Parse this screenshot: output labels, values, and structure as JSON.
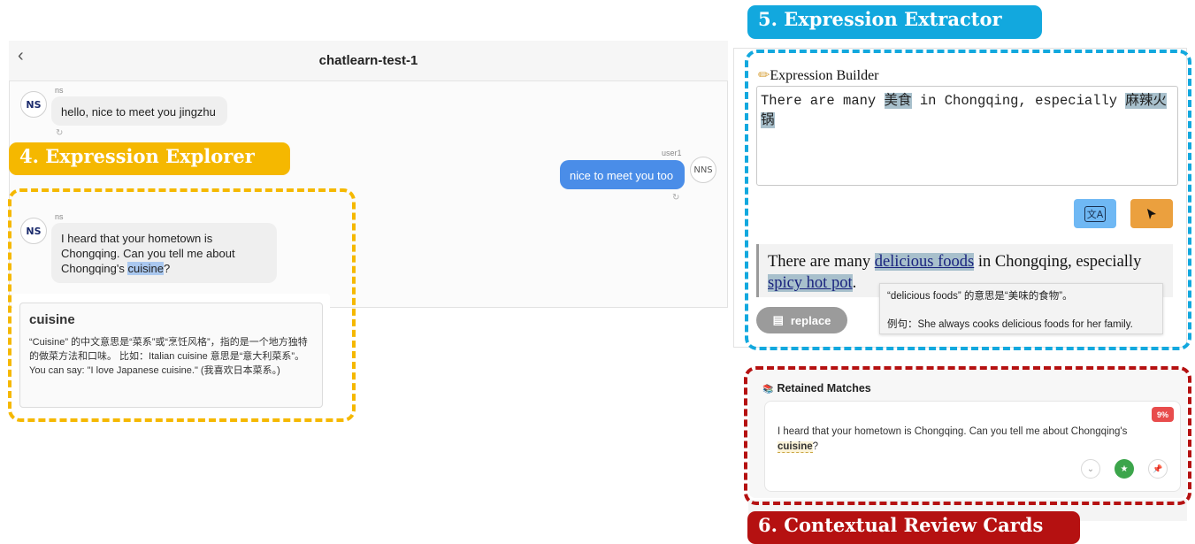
{
  "chat": {
    "back_icon": "‹",
    "title": "chatlearn-test-1",
    "messages": [
      {
        "sender": "ns",
        "avatar": "NS",
        "text": "hello, nice to meet you jingzhu"
      },
      {
        "sender": "user1",
        "avatar": "NNS",
        "text": "nice to meet you too"
      },
      {
        "sender": "ns",
        "avatar": "NS",
        "text_before": "I heard that your hometown is Chongqing. Can you tell me about Chongqing's ",
        "highlighted": "cuisine",
        "text_after": "?"
      }
    ]
  },
  "explorer": {
    "tag": "4. Expression Explorer",
    "word": "cuisine",
    "explanation": "“Cuisine” 的中文意思是“菜系”或“烹饪风格”，指的是一个地方独特的做菜方法和口味。 比如：Italian cuisine 意思是“意大利菜系”。 You can say: \"I love Japanese cuisine.\" (我喜欢日本菜系。)"
  },
  "extractor": {
    "tag": "5. Expression Extractor",
    "title_icon": "✏",
    "title": "Expression Builder",
    "input": {
      "p1": "There are many ",
      "hl1": "美食",
      "p2": " in Chongqing, especially ",
      "hl2": "麻辣火锅"
    },
    "translate_icon": "文A",
    "cursor_icon": "➤",
    "result": {
      "p1": "There are many ",
      "hl1": "delicious foods",
      "p2": " in Chongqing, especially ",
      "hl2": "spicy hot pot",
      "p3": "."
    },
    "replace_icon": "▤",
    "replace_label": "replace",
    "tooltip": {
      "line1": "“delicious foods” 的意思是“美味的食物”。",
      "line2": "例句：She always cooks delicious foods for her family."
    }
  },
  "review": {
    "tag": "6. Contextual Review Cards",
    "title_icon": "📚",
    "title": "Retained Matches",
    "percent": "9%",
    "text_before": "I heard that your hometown is Chongqing. Can you tell me about Chongqing's ",
    "word": "cuisine",
    "text_after": "?",
    "expand_icon": "⌄",
    "star_icon": "★",
    "pin_icon": "📌"
  },
  "colors": {
    "explorer": "#f5b800",
    "extractor": "#12a8de",
    "review": "#b51111",
    "my_bubble": "#4a8de8"
  }
}
